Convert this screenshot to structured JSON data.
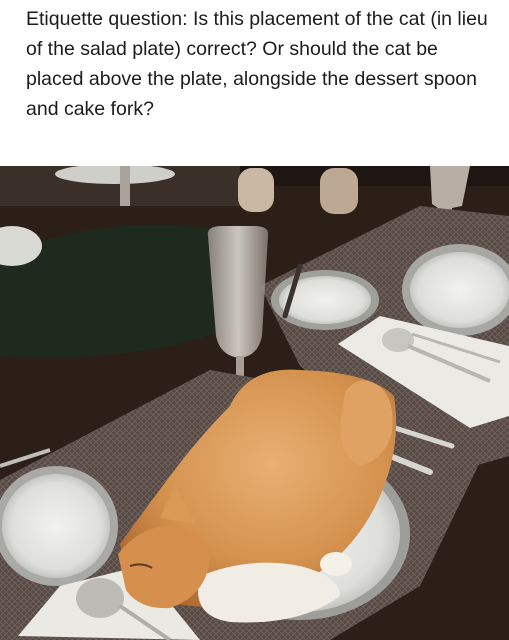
{
  "post": {
    "caption": "Etiquette question: Is this placement of the cat (in lieu of the salad plate) correct? Or should the cat be placed above the plate, alongside the dessert spoon and cake fork?"
  },
  "photo": {
    "subject": "orange-and-white-cat-on-dinner-plate",
    "colors": {
      "table": "#2a1e16",
      "placemat": "#5c4e48",
      "plate": "#e6e6e2",
      "cat_orange": "#d99a56",
      "cat_white": "#f1ece4"
    }
  }
}
